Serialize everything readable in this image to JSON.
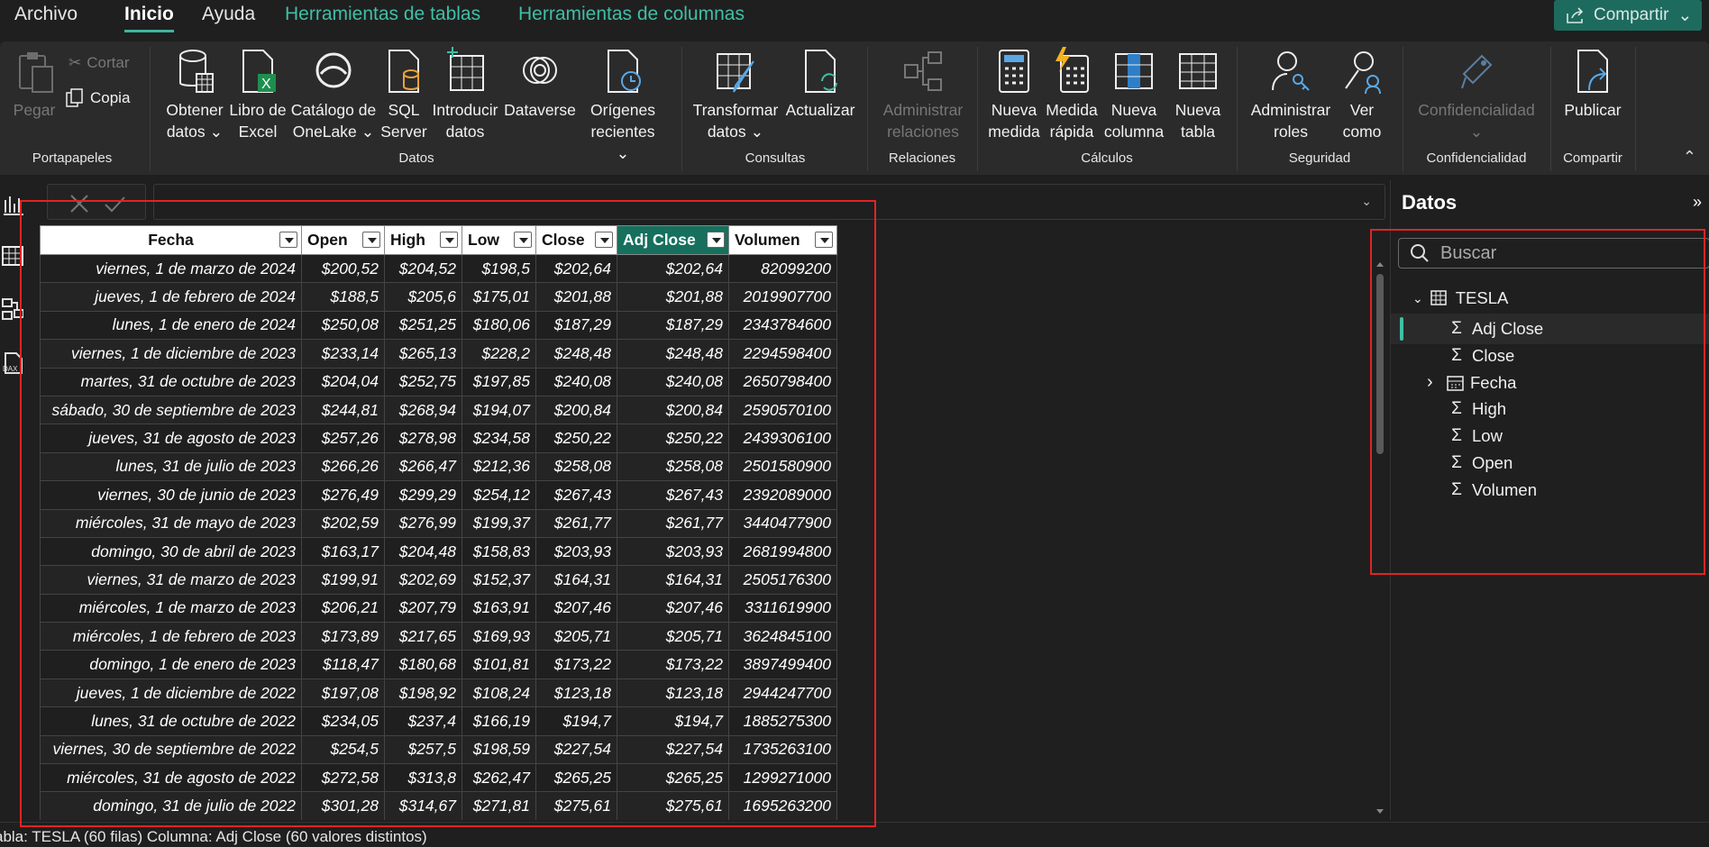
{
  "menu": {
    "archivo": "Archivo",
    "inicio": "Inicio",
    "ayuda": "Ayuda",
    "herr_tablas": "Herramientas de tablas",
    "herr_columnas": "Herramientas de columnas",
    "compartir": "Compartir"
  },
  "ribbon": {
    "portapapeles": {
      "label": "Portapapeles",
      "pegar": "Pegar",
      "cortar": "Cortar",
      "copia": "Copia"
    },
    "datos": {
      "label": "Datos",
      "obtener_1": "Obtener",
      "obtener_2": "datos ⌄",
      "libro_1": "Libro de",
      "libro_2": "Excel",
      "catalogo_1": "Catálogo de",
      "catalogo_2": "OneLake ⌄",
      "sql_1": "SQL",
      "sql_2": "Server",
      "introducir_1": "Introducir",
      "introducir_2": "datos",
      "dataverse": "Dataverse",
      "origenes_1": "Orígenes",
      "origenes_2": "recientes ⌄"
    },
    "consultas": {
      "label": "Consultas",
      "transformar_1": "Transformar",
      "transformar_2": "datos ⌄",
      "actualizar": "Actualizar"
    },
    "relaciones": {
      "label": "Relaciones",
      "administrar_1": "Administrar",
      "administrar_2": "relaciones"
    },
    "calculos": {
      "label": "Cálculos",
      "nueva_medida_1": "Nueva",
      "nueva_medida_2": "medida",
      "medida_rapida_1": "Medida",
      "medida_rapida_2": "rápida",
      "nueva_columna_1": "Nueva",
      "nueva_columna_2": "columna",
      "nueva_tabla_1": "Nueva",
      "nueva_tabla_2": "tabla"
    },
    "seguridad": {
      "label": "Seguridad",
      "administrar_roles_1": "Administrar",
      "administrar_roles_2": "roles",
      "ver_como_1": "Ver",
      "ver_como_2": "como"
    },
    "confidencialidad": {
      "label": "Confidencialidad",
      "btn": "Confidencialidad"
    },
    "compartir": {
      "label": "Compartir",
      "publicar": "Publicar"
    }
  },
  "table": {
    "columns": [
      "Fecha",
      "Open",
      "High",
      "Low",
      "Close",
      "Adj Close",
      "Volumen"
    ],
    "selected_column": "Adj Close",
    "rows": [
      [
        "viernes, 1 de marzo de 2024",
        "$200,52",
        "$204,52",
        "$198,5",
        "$202,64",
        "$202,64",
        "82099200"
      ],
      [
        "jueves, 1 de febrero de 2024",
        "$188,5",
        "$205,6",
        "$175,01",
        "$201,88",
        "$201,88",
        "2019907700"
      ],
      [
        "lunes, 1 de enero de 2024",
        "$250,08",
        "$251,25",
        "$180,06",
        "$187,29",
        "$187,29",
        "2343784600"
      ],
      [
        "viernes, 1 de diciembre de 2023",
        "$233,14",
        "$265,13",
        "$228,2",
        "$248,48",
        "$248,48",
        "2294598400"
      ],
      [
        "martes, 31 de octubre de 2023",
        "$204,04",
        "$252,75",
        "$197,85",
        "$240,08",
        "$240,08",
        "2650798400"
      ],
      [
        "sábado, 30 de septiembre de 2023",
        "$244,81",
        "$268,94",
        "$194,07",
        "$200,84",
        "$200,84",
        "2590570100"
      ],
      [
        "jueves, 31 de agosto de 2023",
        "$257,26",
        "$278,98",
        "$234,58",
        "$250,22",
        "$250,22",
        "2439306100"
      ],
      [
        "lunes, 31 de julio de 2023",
        "$266,26",
        "$266,47",
        "$212,36",
        "$258,08",
        "$258,08",
        "2501580900"
      ],
      [
        "viernes, 30 de junio de 2023",
        "$276,49",
        "$299,29",
        "$254,12",
        "$267,43",
        "$267,43",
        "2392089000"
      ],
      [
        "miércoles, 31 de mayo de 2023",
        "$202,59",
        "$276,99",
        "$199,37",
        "$261,77",
        "$261,77",
        "3440477900"
      ],
      [
        "domingo, 30 de abril de 2023",
        "$163,17",
        "$204,48",
        "$158,83",
        "$203,93",
        "$203,93",
        "2681994800"
      ],
      [
        "viernes, 31 de marzo de 2023",
        "$199,91",
        "$202,69",
        "$152,37",
        "$164,31",
        "$164,31",
        "2505176300"
      ],
      [
        "miércoles, 1 de marzo de 2023",
        "$206,21",
        "$207,79",
        "$163,91",
        "$207,46",
        "$207,46",
        "3311619900"
      ],
      [
        "miércoles, 1 de febrero de 2023",
        "$173,89",
        "$217,65",
        "$169,93",
        "$205,71",
        "$205,71",
        "3624845100"
      ],
      [
        "domingo, 1 de enero de 2023",
        "$118,47",
        "$180,68",
        "$101,81",
        "$173,22",
        "$173,22",
        "3897499400"
      ],
      [
        "jueves, 1 de diciembre de 2022",
        "$197,08",
        "$198,92",
        "$108,24",
        "$123,18",
        "$123,18",
        "2944247700"
      ],
      [
        "lunes, 31 de octubre de 2022",
        "$234,05",
        "$237,4",
        "$166,19",
        "$194,7",
        "$194,7",
        "1885275300"
      ],
      [
        "viernes, 30 de septiembre de 2022",
        "$254,5",
        "$257,5",
        "$198,59",
        "$227,54",
        "$227,54",
        "1735263100"
      ],
      [
        "miércoles, 31 de agosto de 2022",
        "$272,58",
        "$313,8",
        "$262,47",
        "$265,25",
        "$265,25",
        "1299271000"
      ],
      [
        "domingo, 31 de julio de 2022",
        "$301,28",
        "$314,67",
        "$271,81",
        "$275,61",
        "$275,61",
        "1695263200"
      ]
    ]
  },
  "data_pane": {
    "title": "Datos",
    "search_placeholder": "Buscar",
    "table_name": "TESLA",
    "fields": [
      {
        "name": "Adj Close",
        "type": "sigma",
        "selected": true
      },
      {
        "name": "Close",
        "type": "sigma"
      },
      {
        "name": "Fecha",
        "type": "date"
      },
      {
        "name": "High",
        "type": "sigma"
      },
      {
        "name": "Low",
        "type": "sigma"
      },
      {
        "name": "Open",
        "type": "sigma"
      },
      {
        "name": "Volumen",
        "type": "sigma"
      }
    ]
  },
  "status": "abla: TESLA (60 filas) Columna: Adj Close (60 valores distintos)",
  "colors": {
    "accent": "#3fbfa6",
    "selected_header": "#16705d",
    "share": "#1d6b5e",
    "annotation": "#e02424"
  }
}
